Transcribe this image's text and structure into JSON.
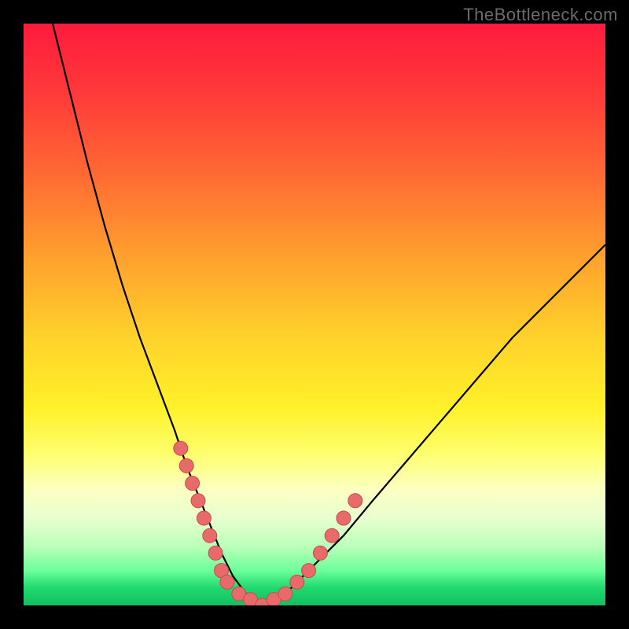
{
  "watermark": "TheBottleneck.com",
  "colors": {
    "background": "#000000",
    "curve_stroke": "#000000",
    "marker_fill": "#e86a6a",
    "marker_stroke": "#c44d4d"
  },
  "chart_data": {
    "type": "line",
    "title": "",
    "xlabel": "",
    "ylabel": "",
    "xlim": [
      0,
      100
    ],
    "ylim": [
      0,
      100
    ],
    "grid": false,
    "series": [
      {
        "name": "bottleneck-curve",
        "x": [
          5,
          8,
          11,
          14,
          17,
          20,
          23,
          26,
          28,
          30,
          32,
          34,
          36,
          37.5,
          39,
          41,
          43,
          46,
          50,
          55,
          60,
          66,
          72,
          78,
          84,
          90,
          96,
          100
        ],
        "y": [
          100,
          88,
          76,
          65,
          55,
          46,
          38,
          30,
          24,
          19,
          14,
          9,
          5,
          3,
          1,
          0,
          1,
          3,
          7,
          12,
          18,
          25,
          32,
          39,
          46,
          52,
          58,
          62
        ]
      }
    ],
    "markers": {
      "name": "highlighted-points",
      "x": [
        27,
        28,
        29,
        30,
        31,
        32,
        33,
        34,
        35,
        37,
        39,
        41,
        43,
        45,
        47,
        49,
        51,
        53,
        55,
        57
      ],
      "y": [
        27,
        24,
        21,
        18,
        15,
        12,
        9,
        6,
        4,
        2,
        1,
        0,
        1,
        2,
        4,
        6,
        9,
        12,
        15,
        18
      ]
    }
  }
}
